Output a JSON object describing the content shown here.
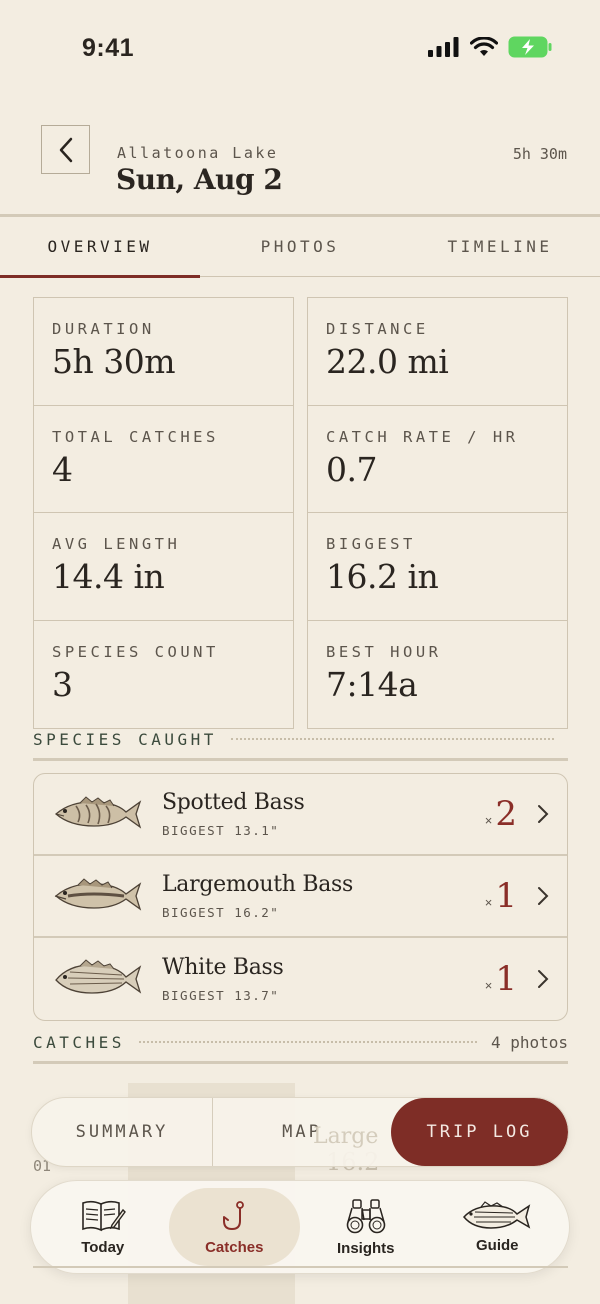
{
  "status_bar": {
    "time": "9:41"
  },
  "header": {
    "lake": "Allatoona Lake",
    "date": "Sun, Aug 2",
    "duration": "5h 30m"
  },
  "tabs": [
    {
      "label": "OVERVIEW",
      "active": true
    },
    {
      "label": "PHOTOS",
      "active": false
    },
    {
      "label": "TIMELINE",
      "active": false
    }
  ],
  "stats": {
    "left": [
      {
        "label": "DURATION",
        "value": "5h 30m"
      },
      {
        "label": "TOTAL CATCHES",
        "value": "4"
      },
      {
        "label": "AVG LENGTH",
        "value": "14.4 in"
      },
      {
        "label": "SPECIES COUNT",
        "value": "3"
      }
    ],
    "right": [
      {
        "label": "DISTANCE",
        "value": "22.0 mi"
      },
      {
        "label": "CATCH RATE / HR",
        "value": "0.7"
      },
      {
        "label": "BIGGEST",
        "value": "16.2 in"
      },
      {
        "label": "BEST HOUR",
        "value": "7:14a"
      }
    ]
  },
  "species_section": {
    "title": "SPECIES CAUGHT"
  },
  "species": [
    {
      "name": "Spotted Bass",
      "biggest": "BIGGEST 13.1\"",
      "x": "×",
      "count": "2"
    },
    {
      "name": "Largemouth Bass",
      "biggest": "BIGGEST 16.2\"",
      "x": "×",
      "count": "1"
    },
    {
      "name": "White Bass",
      "biggest": "BIGGEST 13.7\"",
      "x": "×",
      "count": "1"
    }
  ],
  "catches_section": {
    "title": "CATCHES",
    "photos": "4 photos"
  },
  "catch_preview": {
    "index": "01",
    "name": "Large",
    "length": "16.2"
  },
  "segmented": {
    "summary": "SUMMARY",
    "map": "MAP",
    "trip_log": "TRIP LOG"
  },
  "tabbar": {
    "today": "Today",
    "catches": "Catches",
    "insights": "Insights",
    "guide": "Guide"
  },
  "colors": {
    "background": "#f3ede1",
    "accent": "#7e2d26",
    "rule": "#d3cab8",
    "count": "#8a2e28"
  }
}
